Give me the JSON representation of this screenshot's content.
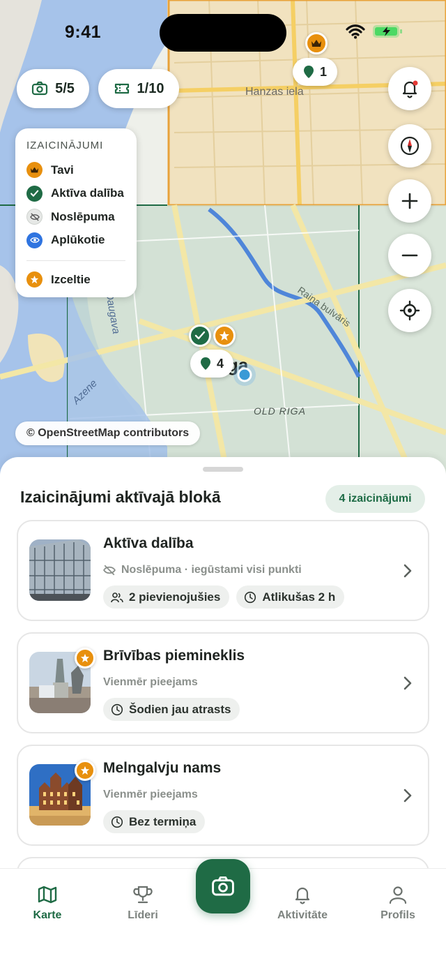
{
  "status_bar": {
    "time": "9:41"
  },
  "map": {
    "labels": {
      "street_hanzas": "Hanzas iela",
      "street_raina": "Raiņa bulvāris",
      "city": "Riga",
      "old_riga": "OLD RIGA",
      "river_daugava": "Daugava",
      "azene": "Azene"
    },
    "pills": {
      "photos": "5/5",
      "tickets": "1/10"
    },
    "legend": {
      "title": "IZAICINĀJUMI",
      "items": [
        {
          "label": "Tavi",
          "color": "#e8900e",
          "icon": "crown-icon"
        },
        {
          "label": "Aktīva dalība",
          "color": "#1f6b45",
          "icon": "check-icon"
        },
        {
          "label": "Noslēpuma",
          "color": "#e6e8e6",
          "icon": "eye-off-icon"
        },
        {
          "label": "Aplūkotie",
          "color": "#2f74e0",
          "icon": "eye-icon"
        }
      ],
      "highlighted": {
        "label": "Izceltie",
        "color": "#e8900e",
        "icon": "star-icon"
      }
    },
    "markers": {
      "top_count": "1",
      "center_count": "4"
    },
    "attribution": "© OpenStreetMap contributors"
  },
  "sheet": {
    "title": "Izaicinājumi aktīvajā blokā",
    "count_chip": "4 izaicinājumi",
    "cards": [
      {
        "title": "Aktīva dalība",
        "subtitle": "Noslēpuma · iegūstami visi punkti",
        "chips": [
          "2 pievienojušies",
          "Atlikušas 2 h"
        ]
      },
      {
        "title": "Brīvības piemineklis",
        "subtitle": "Vienmēr pieejams",
        "chips": [
          "Šodien jau atrasts"
        ]
      },
      {
        "title": "Melngalvju nams",
        "subtitle": "Vienmēr pieejams",
        "chips": [
          "Bez termiņa"
        ]
      }
    ]
  },
  "tabbar": {
    "tabs": [
      {
        "label": "Karte",
        "active": true
      },
      {
        "label": "Līderi",
        "active": false
      },
      {
        "label": "Aktivitāte",
        "active": false
      },
      {
        "label": "Profils",
        "active": false
      }
    ]
  },
  "colors": {
    "primary_green": "#1f6b45",
    "accent_orange": "#e8900e",
    "blue": "#2f74e0"
  }
}
